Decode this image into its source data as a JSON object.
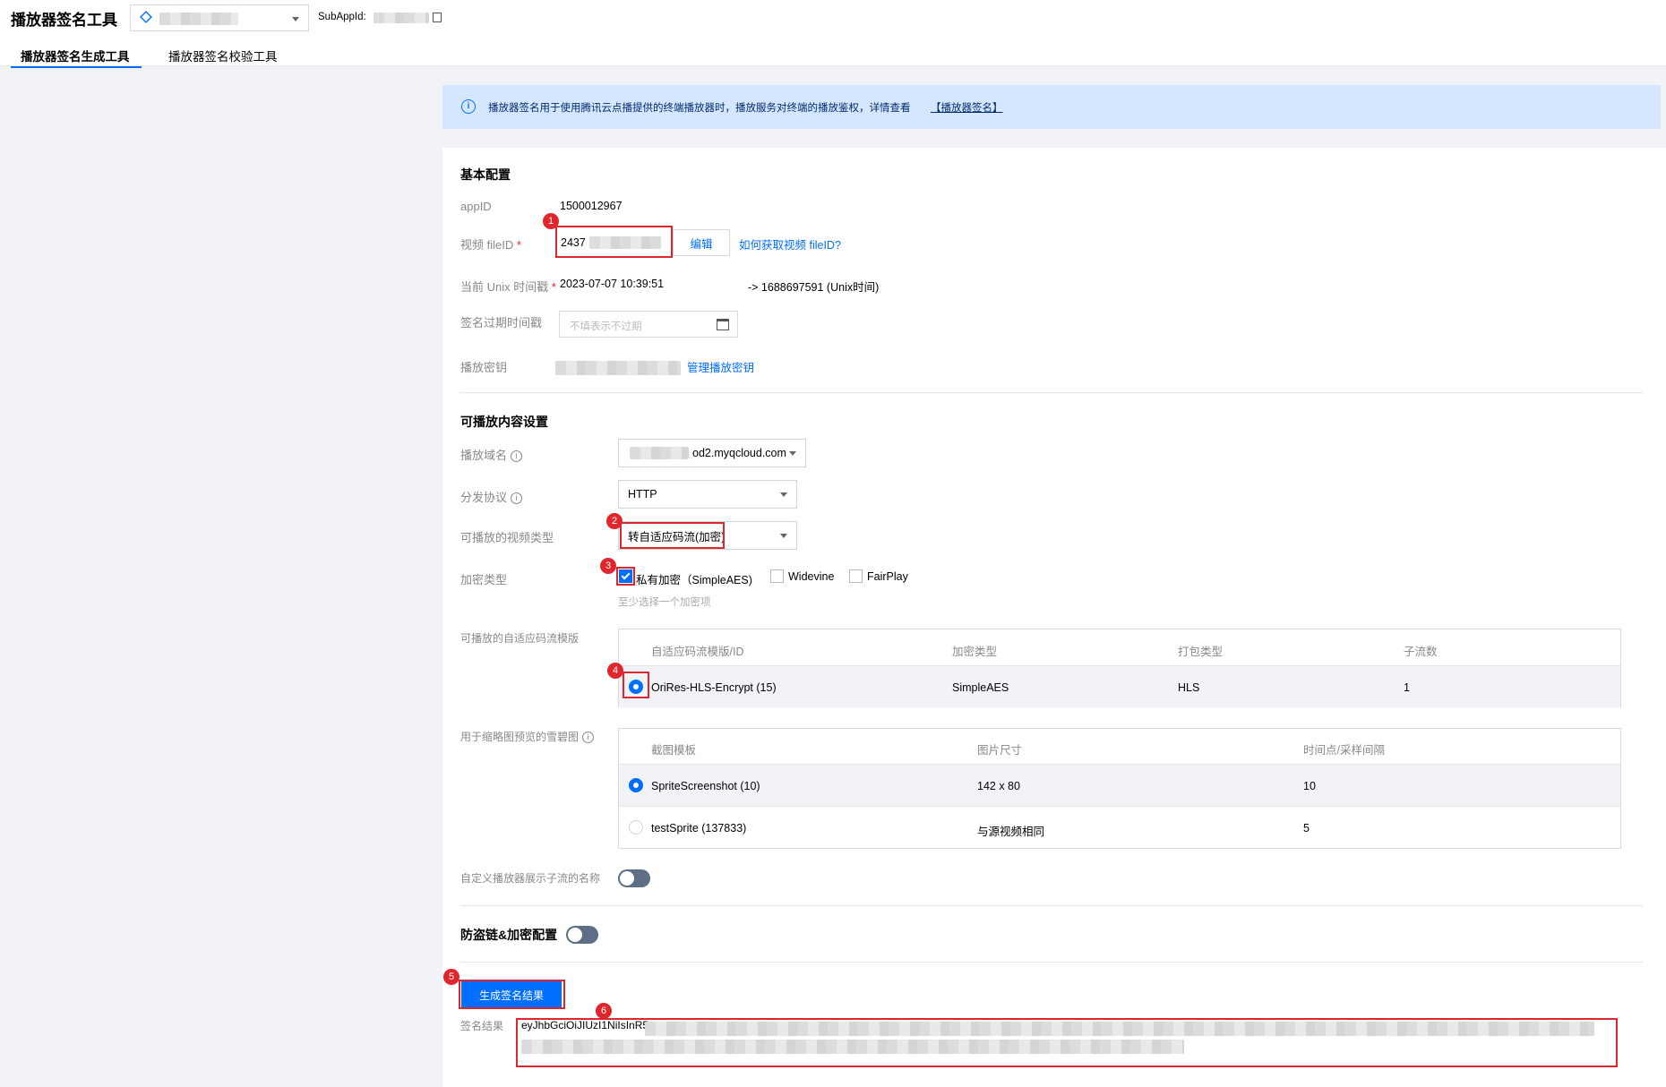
{
  "header": {
    "title": "播放器签名工具",
    "subappid_label": "SubAppId:",
    "tabs": [
      {
        "label": "播放器签名生成工具",
        "active": true
      },
      {
        "label": "播放器签名校验工具",
        "active": false
      }
    ]
  },
  "notice": {
    "text": "播放器签名用于使用腾讯云点播提供的终端播放器时，播放服务对终端的播放鉴权，详情查看",
    "link": "【播放器签名】"
  },
  "basic": {
    "section_title": "基本配置",
    "appid_label": "appID",
    "appid_value": "1500012967",
    "fileid_label": "视频 fileID",
    "fileid_value": "2437",
    "edit_button": "编辑",
    "fileid_help_link": "如何获取视频 fileID?",
    "unix_label": "当前 Unix 时间戳",
    "unix_date": "2023-07-07 10:39:51",
    "unix_converted": "-> 1688697591 (Unix时间)",
    "expire_label": "签名过期时间戳",
    "expire_placeholder": "不填表示不过期",
    "key_label": "播放密钥",
    "key_manage_link": "管理播放密钥"
  },
  "playable": {
    "section_title": "可播放内容设置",
    "domain_label": "播放域名",
    "domain_value": "od2.myqcloud.com",
    "protocol_label": "分发协议",
    "protocol_value": "HTTP",
    "video_type_label": "可播放的视频类型",
    "video_type_value": "转自适应码流(加密)",
    "encrypt_label": "加密类型",
    "encrypt_options": [
      {
        "label": "私有加密（SimpleAES)",
        "checked": true
      },
      {
        "label": "Widevine",
        "checked": false
      },
      {
        "label": "FairPlay",
        "checked": false
      }
    ],
    "encrypt_hint": "至少选择一个加密项",
    "adaptive_label": "可播放的自适应码流模版",
    "adaptive_headers": [
      "自适应码流模版/ID",
      "加密类型",
      "打包类型",
      "子流数"
    ],
    "adaptive_rows": [
      {
        "cells": [
          "OriRes-HLS-Encrypt (15)",
          "SimpleAES",
          "HLS",
          "1"
        ],
        "selected": true
      }
    ],
    "sprite_label": "用于缩略图预览的雪碧图",
    "sprite_headers": [
      "截图模板",
      "图片尺寸",
      "时间点/采样间隔"
    ],
    "sprite_rows": [
      {
        "cells": [
          "SpriteScreenshot (10)",
          "142 x 80",
          "10"
        ],
        "selected": true
      },
      {
        "cells": [
          "testSprite (137833)",
          "与源视频相同",
          "5"
        ],
        "selected": false
      }
    ],
    "custom_name_label": "自定义播放器展示子流的名称",
    "custom_name_enabled": false
  },
  "antitheft": {
    "label": "防盗链&加密配置",
    "enabled": false
  },
  "result": {
    "generate_button": "生成签名结果",
    "result_label": "签名结果",
    "result_value": "eyJhbGciOiJIUzI1NiIsInR5"
  },
  "annotations": [
    "1",
    "2",
    "3",
    "4",
    "5",
    "6"
  ],
  "colors": {
    "accent": "#006eff",
    "annotation": "#e0262d",
    "notice_bg": "#d5e7ff"
  }
}
